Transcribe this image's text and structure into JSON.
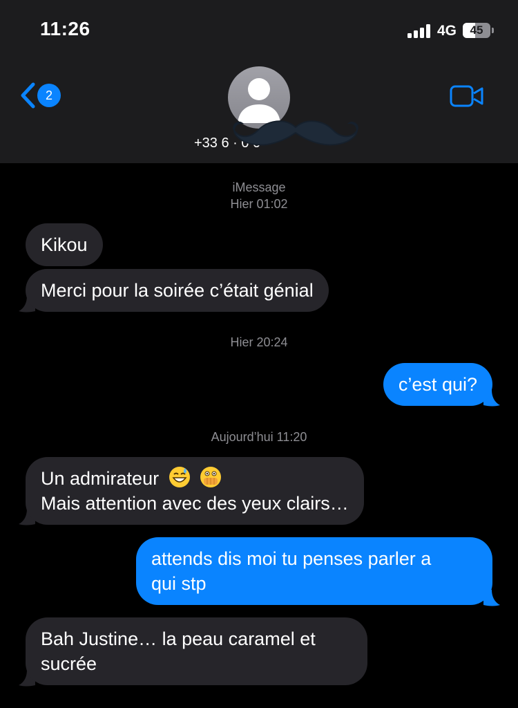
{
  "status_bar": {
    "time": "11:26",
    "network": "4G",
    "battery_level": "45",
    "battery_fraction": 0.45,
    "signal_bars": 4
  },
  "header": {
    "back_badge": "2",
    "contact_name": "+33 6 · 0 0",
    "icons": {
      "back": "chevron-left-icon",
      "avatar": "person-icon",
      "video": "video-camera-icon"
    }
  },
  "thread": {
    "service_label": "iMessage",
    "stamps": [
      "Hier 01:02",
      "Hier 20:24",
      "Aujourd’hui 11:20"
    ],
    "messages": [
      {
        "direction": "in",
        "text": "Kikou"
      },
      {
        "direction": "in",
        "text": "Merci pour la soirée c’était génial"
      },
      {
        "direction": "out",
        "text": "c’est qui?"
      },
      {
        "direction": "in",
        "text": "Un admirateur",
        "emojis": [
          "grinning-sweat-emoji",
          "face-with-open-eyes-and-hand-over-mouth-emoji"
        ],
        "line2": "Mais attention avec des yeux clairs…"
      },
      {
        "direction": "out",
        "text": "attends dis moi tu penses parler a",
        "line2": "qui stp"
      },
      {
        "direction": "in",
        "text": "Bah Justine… la peau caramel et",
        "line2": "sucrée"
      }
    ]
  },
  "colors": {
    "header_bg": "#1c1c1e",
    "background": "#000000",
    "incoming_bubble": "#26252a",
    "outgoing_bubble": "#0a84ff",
    "accent": "#0a84ff",
    "timestamp_text": "#8e8e93"
  }
}
